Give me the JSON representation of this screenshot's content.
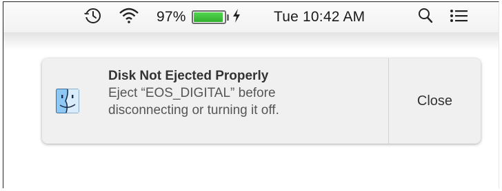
{
  "menubar": {
    "time_machine_icon": "time-machine-icon",
    "wifi_icon": "wifi-icon",
    "battery": {
      "percent_label": "97%",
      "level": 0.97,
      "charging_icon": "charging-bolt-icon",
      "fill_color": "#3cc23a"
    },
    "clock": "Tue 10:42 AM",
    "spotlight_icon": "spotlight-search-icon",
    "notification_center_icon": "notification-center-icon"
  },
  "notification": {
    "app_icon": "finder-icon",
    "title": "Disk Not Ejected Properly",
    "body_line1": "Eject “EOS_DIGITAL” before",
    "body_line2": "disconnecting or turning it off.",
    "close_label": "Close"
  }
}
